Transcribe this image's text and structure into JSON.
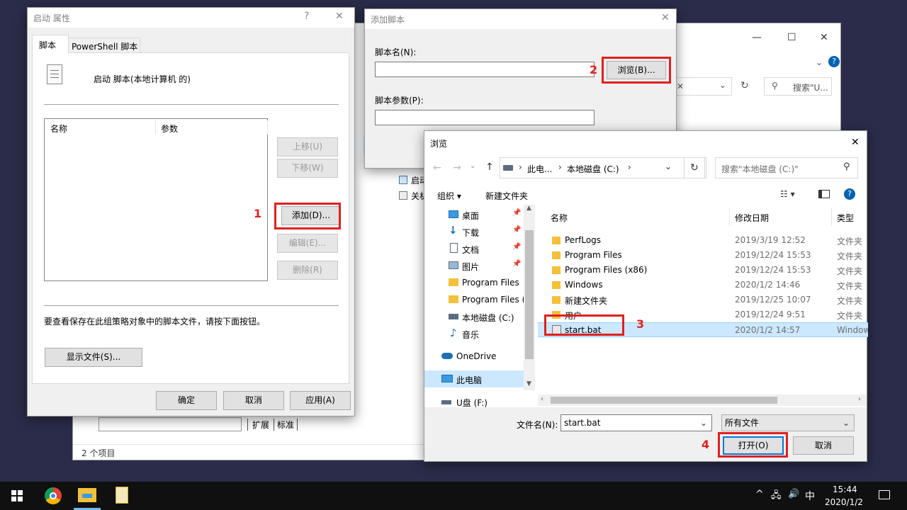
{
  "props": {
    "title": "启动 属性",
    "help": "?",
    "close": "✕",
    "tabs": [
      "脚本",
      "PowerShell 脚本"
    ],
    "heading": "启动 脚本(本地计算机 的)",
    "cols": [
      "名称",
      "参数"
    ],
    "up": "上移(U)",
    "down": "下移(W)",
    "add": "添加(D)...",
    "edit": "编辑(E)...",
    "remove": "删除(R)",
    "info": "要查看保存在此组策略对象中的脚本文件，请按下面按钮。",
    "show_files": "显示文件(S)...",
    "ok": "确定",
    "cancel": "取消",
    "apply": "应用(A)"
  },
  "add_script": {
    "title": "添加脚本",
    "close": "✕",
    "name_label": "脚本名(N):",
    "browse": "浏览(B)...",
    "params_label": "脚本参数(P):"
  },
  "behind": {
    "status": "2 个项目",
    "tabs": [
      "扩展",
      "标准"
    ],
    "search": "搜索\"U...",
    "items": [
      "启动",
      "关机"
    ],
    "min": "—",
    "max": "☐",
    "close": "✕"
  },
  "browse": {
    "title": "浏览",
    "close": "✕",
    "path": [
      "此电...",
      "本地磁盘 (C:)"
    ],
    "search_placeholder": "搜索\"本地磁盘 (C:)\"",
    "organize": "组织 ▾",
    "new_folder": "新建文件夹",
    "nav": [
      {
        "name": "桌面",
        "pin": true
      },
      {
        "name": "下载",
        "pin": true
      },
      {
        "name": "文档",
        "pin": true
      },
      {
        "name": "图片",
        "pin": true
      },
      {
        "name": "Program Files",
        "pin": false
      },
      {
        "name": "Program Files (",
        "pin": false
      },
      {
        "name": "本地磁盘 (C:)",
        "pin": false
      },
      {
        "name": "音乐",
        "pin": false
      },
      {
        "name": "OneDrive",
        "pin": false
      },
      {
        "name": "此电脑",
        "pin": false
      },
      {
        "name": "U盘 (F:)",
        "pin": false
      }
    ],
    "cols": [
      "名称",
      "修改日期",
      "类型"
    ],
    "files": [
      {
        "name": "PerfLogs",
        "date": "2019/3/19 12:52",
        "type": "文件夹"
      },
      {
        "name": "Program Files",
        "date": "2019/12/24 15:53",
        "type": "文件夹"
      },
      {
        "name": "Program Files (x86)",
        "date": "2019/12/24 15:53",
        "type": "文件夹"
      },
      {
        "name": "Windows",
        "date": "2020/1/2 14:46",
        "type": "文件夹"
      },
      {
        "name": "新建文件夹",
        "date": "2019/12/25 10:07",
        "type": "文件夹"
      },
      {
        "name": "用户",
        "date": "2019/12/24 9:51",
        "type": "文件夹"
      },
      {
        "name": "start.bat",
        "date": "2020/1/2 14:57",
        "type": "Windows"
      }
    ],
    "filename_label": "文件名(N):",
    "filename_value": "start.bat",
    "filter": "所有文件",
    "open": "打开(O)",
    "cancel": "取消"
  },
  "steps": [
    "1",
    "2",
    "3",
    "4"
  ],
  "taskbar": {
    "time": "15:44",
    "date": "2020/1/2",
    "ime": "中"
  },
  "colors": {
    "highlight": "#e0201d",
    "accent": "#0078d7",
    "desktop": "#2a2c49"
  }
}
